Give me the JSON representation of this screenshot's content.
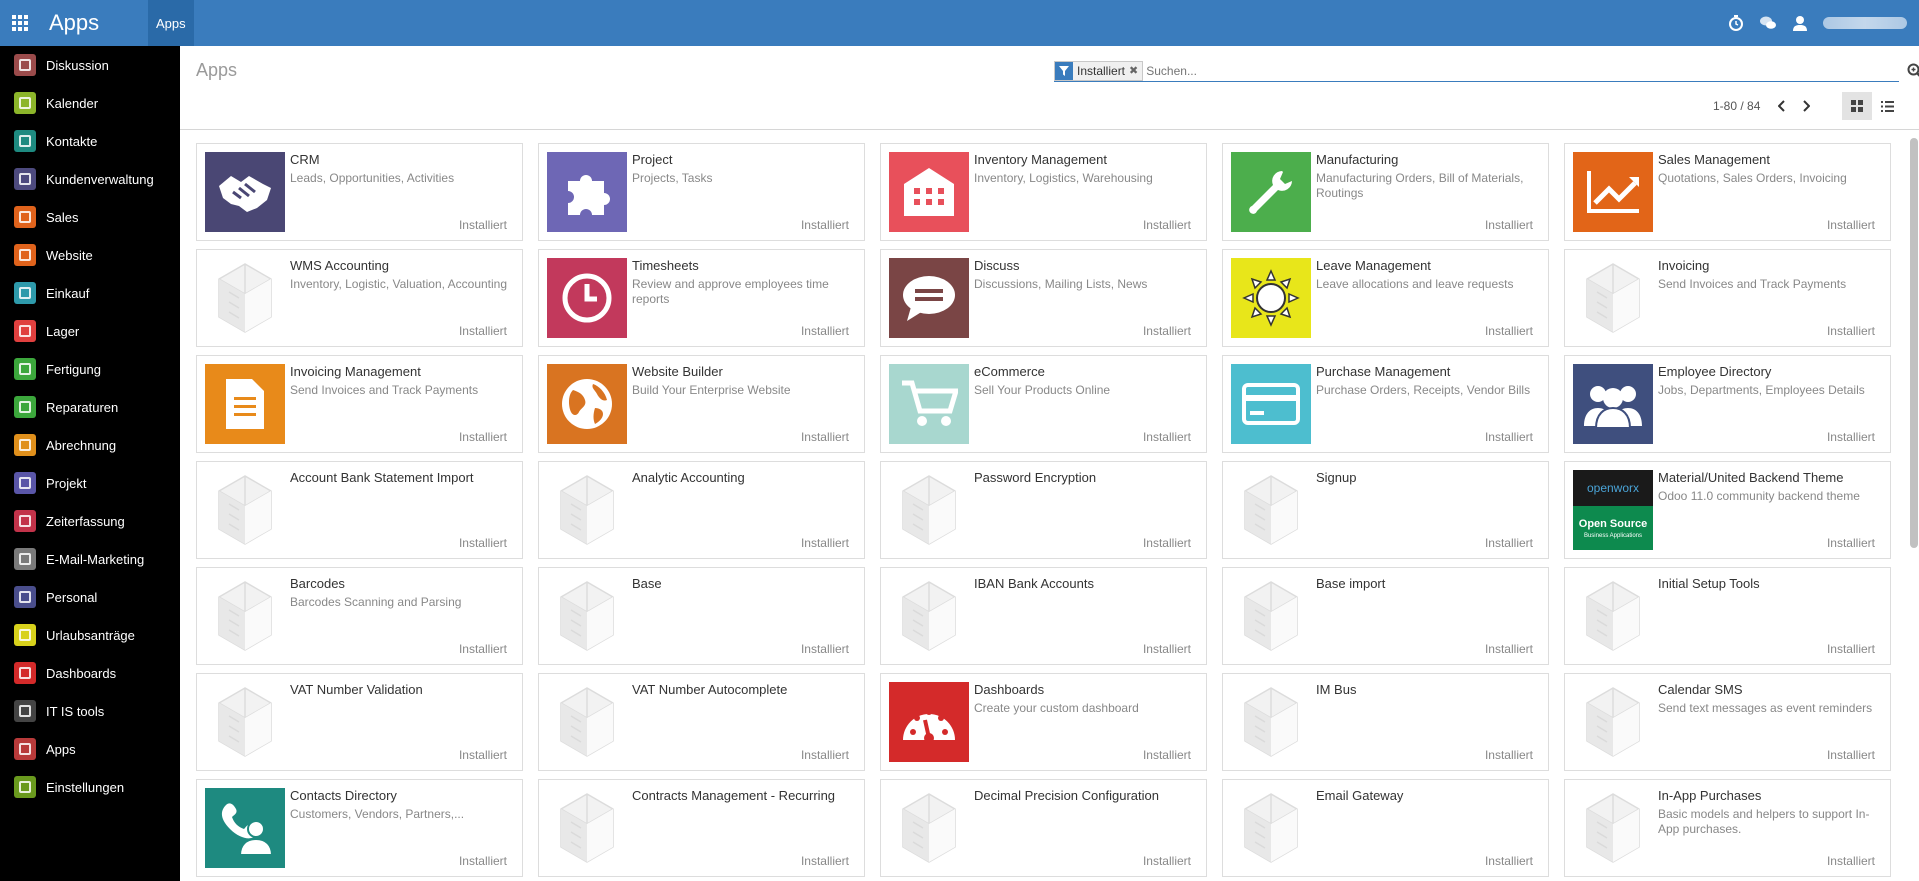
{
  "topbar": {
    "brand": "Apps",
    "menu": "Apps"
  },
  "icons": {
    "apps_menu": "grid-icon",
    "activity": "clock-icon",
    "messaging": "chat-icon",
    "user": "user-avatar-icon"
  },
  "colors": {
    "primary": "#3a7cbd",
    "sidebar_bg": "#000000"
  },
  "sidebar": {
    "items": [
      {
        "label": "Diskussion",
        "color": "#9b4b4b"
      },
      {
        "label": "Kalender",
        "color": "#8cb52a"
      },
      {
        "label": "Kontakte",
        "color": "#1e8a80"
      },
      {
        "label": "Kundenverwaltung",
        "color": "#4d4a7e"
      },
      {
        "label": "Sales",
        "color": "#e0631c"
      },
      {
        "label": "Website",
        "color": "#e0631c"
      },
      {
        "label": "Einkauf",
        "color": "#2e9aab"
      },
      {
        "label": "Lager",
        "color": "#e0403f"
      },
      {
        "label": "Fertigung",
        "color": "#3ca73c"
      },
      {
        "label": "Reparaturen",
        "color": "#3ca73c"
      },
      {
        "label": "Abrechnung",
        "color": "#e0901c"
      },
      {
        "label": "Projekt",
        "color": "#5a56a8"
      },
      {
        "label": "Zeiterfassung",
        "color": "#c2334a"
      },
      {
        "label": "E-Mail-Marketing",
        "color": "#7a7a7a"
      },
      {
        "label": "Personal",
        "color": "#4a4e8c"
      },
      {
        "label": "Urlaubsanträge",
        "color": "#d8d21c"
      },
      {
        "label": "Dashboards",
        "color": "#d42a2a"
      },
      {
        "label": "IT IS tools",
        "color": "#444444"
      },
      {
        "label": "Apps",
        "color": "#b83a3a"
      },
      {
        "label": "Einstellungen",
        "color": "#6a9a1e"
      }
    ]
  },
  "control_panel": {
    "title": "Apps",
    "facet_label": "Installiert",
    "search_placeholder": "Suchen...",
    "pager": "1-80 / 84"
  },
  "apps": [
    {
      "title": "CRM",
      "subtitle": "Leads, Opportunities, Activities",
      "status": "Installiert",
      "icon": "handshake-icon",
      "color": "#4a4774"
    },
    {
      "title": "Project",
      "subtitle": "Projects, Tasks",
      "status": "Installiert",
      "icon": "puzzle-icon",
      "color": "#6e67b5"
    },
    {
      "title": "Inventory Management",
      "subtitle": "Inventory, Logistics, Warehousing",
      "status": "Installiert",
      "icon": "warehouse-icon",
      "color": "#e8505b"
    },
    {
      "title": "Manufacturing",
      "subtitle": "Manufacturing Orders, Bill of Materials, Routings",
      "status": "Installiert",
      "icon": "wrench-icon",
      "color": "#4cae4c"
    },
    {
      "title": "Sales Management",
      "subtitle": "Quotations, Sales Orders, Invoicing",
      "status": "Installiert",
      "icon": "trend-chart-icon",
      "color": "#e26518"
    },
    {
      "title": "WMS Accounting",
      "subtitle": "Inventory, Logistic, Valuation, Accounting",
      "status": "Installiert",
      "icon": "default-module-icon",
      "color": ""
    },
    {
      "title": "Timesheets",
      "subtitle": "Review and approve employees time reports",
      "status": "Installiert",
      "icon": "clock-icon",
      "color": "#c2395c"
    },
    {
      "title": "Discuss",
      "subtitle": "Discussions, Mailing Lists, News",
      "status": "Installiert",
      "icon": "speech-bubble-icon",
      "color": "#7a4545"
    },
    {
      "title": "Leave Management",
      "subtitle": "Leave allocations and leave requests",
      "status": "Installiert",
      "icon": "sun-icon",
      "color": "#e8e61a"
    },
    {
      "title": "Invoicing",
      "subtitle": "Send Invoices and Track Payments",
      "status": "Installiert",
      "icon": "default-module-icon",
      "color": ""
    },
    {
      "title": "Invoicing Management",
      "subtitle": "Send Invoices and Track Payments",
      "status": "Installiert",
      "icon": "document-icon",
      "color": "#e88a1a"
    },
    {
      "title": "Website Builder",
      "subtitle": "Build Your Enterprise Website",
      "status": "Installiert",
      "icon": "globe-icon",
      "color": "#d97421"
    },
    {
      "title": "eCommerce",
      "subtitle": "Sell Your Products Online",
      "status": "Installiert",
      "icon": "cart-icon",
      "color": "#a8d7cf"
    },
    {
      "title": "Purchase Management",
      "subtitle": "Purchase Orders, Receipts, Vendor Bills",
      "status": "Installiert",
      "icon": "credit-card-icon",
      "color": "#4dbecf"
    },
    {
      "title": "Employee Directory",
      "subtitle": "Jobs, Departments, Employees Details",
      "status": "Installiert",
      "icon": "people-icon",
      "color": "#3f4f7e"
    },
    {
      "title": "Account Bank Statement Import",
      "subtitle": "",
      "status": "Installiert",
      "icon": "default-module-icon",
      "color": ""
    },
    {
      "title": "Analytic Accounting",
      "subtitle": "",
      "status": "Installiert",
      "icon": "default-module-icon",
      "color": ""
    },
    {
      "title": "Password Encryption",
      "subtitle": "",
      "status": "Installiert",
      "icon": "default-module-icon",
      "color": ""
    },
    {
      "title": "Signup",
      "subtitle": "",
      "status": "Installiert",
      "icon": "default-module-icon",
      "color": ""
    },
    {
      "title": "Material/United Backend Theme",
      "subtitle": "Odoo 11.0 community backend theme",
      "status": "Installiert",
      "icon": "openworx-logo-icon",
      "color": "",
      "logo_top": "openworx",
      "logo_line1": "Open Source",
      "logo_line2": "Business Applications"
    },
    {
      "title": "Barcodes",
      "subtitle": "Barcodes Scanning and Parsing",
      "status": "Installiert",
      "icon": "default-module-icon",
      "color": ""
    },
    {
      "title": "Base",
      "subtitle": "",
      "status": "Installiert",
      "icon": "default-module-icon",
      "color": ""
    },
    {
      "title": "IBAN Bank Accounts",
      "subtitle": "",
      "status": "Installiert",
      "icon": "default-module-icon",
      "color": ""
    },
    {
      "title": "Base import",
      "subtitle": "",
      "status": "Installiert",
      "icon": "default-module-icon",
      "color": ""
    },
    {
      "title": "Initial Setup Tools",
      "subtitle": "",
      "status": "Installiert",
      "icon": "default-module-icon",
      "color": ""
    },
    {
      "title": "VAT Number Validation",
      "subtitle": "",
      "status": "Installiert",
      "icon": "default-module-icon",
      "color": ""
    },
    {
      "title": "VAT Number Autocomplete",
      "subtitle": "",
      "status": "Installiert",
      "icon": "default-module-icon",
      "color": ""
    },
    {
      "title": "Dashboards",
      "subtitle": "Create your custom dashboard",
      "status": "Installiert",
      "icon": "speedometer-icon",
      "color": "#d42a2a"
    },
    {
      "title": "IM Bus",
      "subtitle": "",
      "status": "Installiert",
      "icon": "default-module-icon",
      "color": ""
    },
    {
      "title": "Calendar SMS",
      "subtitle": "Send text messages as event reminders",
      "status": "Installiert",
      "icon": "default-module-icon",
      "color": ""
    },
    {
      "title": "Contacts Directory",
      "subtitle": "Customers, Vendors, Partners,...",
      "status": "Installiert",
      "icon": "phone-contact-icon",
      "color": "#1e8a80"
    },
    {
      "title": "Contracts Management - Recurring",
      "subtitle": "",
      "status": "Installiert",
      "icon": "default-module-icon",
      "color": ""
    },
    {
      "title": "Decimal Precision Configuration",
      "subtitle": "",
      "status": "Installiert",
      "icon": "default-module-icon",
      "color": ""
    },
    {
      "title": "Email Gateway",
      "subtitle": "",
      "status": "Installiert",
      "icon": "default-module-icon",
      "color": ""
    },
    {
      "title": "In-App Purchases",
      "subtitle": "Basic models and helpers to support In-App purchases.",
      "status": "Installiert",
      "icon": "default-module-icon",
      "color": ""
    }
  ]
}
